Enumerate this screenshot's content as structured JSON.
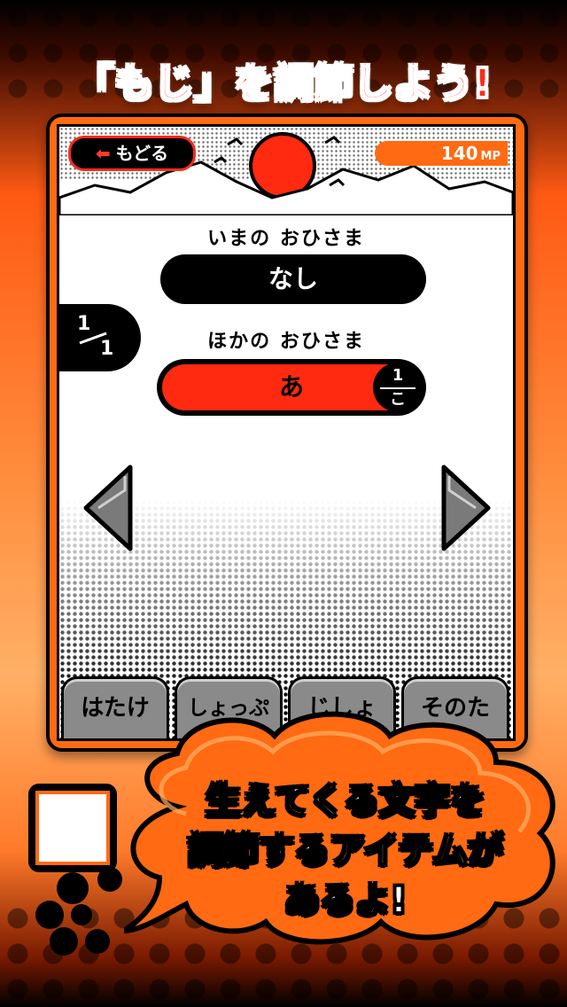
{
  "headline": "「もじ」を調節しよう!",
  "top_bar": {
    "back_label": "もどる",
    "mp_value": "140",
    "mp_unit": "MP"
  },
  "current_sun": {
    "label": "いまの おひさま",
    "value": "なし"
  },
  "other_sun": {
    "label": "ほかの おひさま",
    "value": "あ",
    "count": "1",
    "count_unit": "こ"
  },
  "pager": {
    "current": "1",
    "total": "1"
  },
  "tabs": [
    {
      "label": "はたけ"
    },
    {
      "label": "しょっぷ"
    },
    {
      "label": "じしょ"
    },
    {
      "label": "そのた"
    }
  ],
  "bubble": {
    "line1": "生えてくる文字を",
    "line2": "調節するアイテムが",
    "line3": "あるよ!"
  },
  "colors": {
    "accent_red": "#ff2a10",
    "accent_orange": "#ff6a12"
  }
}
